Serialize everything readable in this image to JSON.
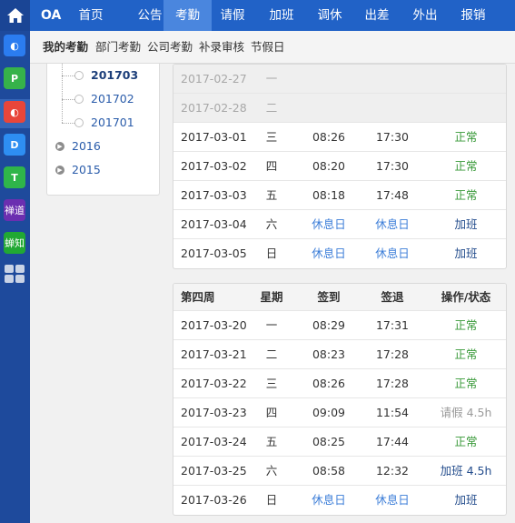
{
  "rail": {
    "apps": [
      {
        "name": "app-c-blue",
        "glyph": "◐",
        "color": "#2b7cf0"
      },
      {
        "name": "app-p-green",
        "glyph": "P",
        "color": "#36b24a"
      },
      {
        "name": "app-d-red",
        "glyph": "◐",
        "color": "#e8463a"
      },
      {
        "name": "app-d-blue",
        "glyph": "D",
        "color": "#2e8ef2"
      },
      {
        "name": "app-t-green",
        "glyph": "T",
        "color": "#2fb54a"
      },
      {
        "name": "app-chandao",
        "glyph": "禅道",
        "color": "#6b2fb0"
      },
      {
        "name": "app-chanzhi",
        "glyph": "蝉知",
        "color": "#21a834"
      }
    ]
  },
  "topbar": {
    "brand": "OA",
    "nav": [
      "首页",
      "公告",
      "考勤",
      "请假",
      "加班",
      "调休",
      "出差",
      "外出",
      "报销"
    ],
    "active": "考勤"
  },
  "subbar": {
    "items": [
      "我的考勤",
      "部门考勤",
      "公司考勤",
      "补录审核",
      "节假日"
    ],
    "active": "我的考勤"
  },
  "tree": {
    "months": [
      "201703",
      "201702",
      "201701"
    ],
    "active_month": "201703",
    "years": [
      "2016",
      "2015"
    ]
  },
  "week_prev": {
    "rows": [
      {
        "date": "2017-02-27",
        "weekday": "一",
        "in": "",
        "out": "",
        "status": "",
        "grey": true
      },
      {
        "date": "2017-02-28",
        "weekday": "二",
        "in": "",
        "out": "",
        "status": "",
        "grey": true
      },
      {
        "date": "2017-03-01",
        "weekday": "三",
        "in": "08:26",
        "out": "17:30",
        "status": "正常"
      },
      {
        "date": "2017-03-02",
        "weekday": "四",
        "in": "08:20",
        "out": "17:30",
        "status": "正常"
      },
      {
        "date": "2017-03-03",
        "weekday": "五",
        "in": "08:18",
        "out": "17:48",
        "status": "正常"
      },
      {
        "date": "2017-03-04",
        "weekday": "六",
        "in": "休息日",
        "out": "休息日",
        "status": "加班"
      },
      {
        "date": "2017-03-05",
        "weekday": "日",
        "in": "休息日",
        "out": "休息日",
        "status": "加班"
      }
    ]
  },
  "week4": {
    "headers": [
      "第四周",
      "星期",
      "签到",
      "签退",
      "操作/状态"
    ],
    "rows": [
      {
        "date": "2017-03-20",
        "weekday": "一",
        "in": "08:29",
        "out": "17:31",
        "status": "正常"
      },
      {
        "date": "2017-03-21",
        "weekday": "二",
        "in": "08:23",
        "out": "17:28",
        "status": "正常"
      },
      {
        "date": "2017-03-22",
        "weekday": "三",
        "in": "08:26",
        "out": "17:28",
        "status": "正常"
      },
      {
        "date": "2017-03-23",
        "weekday": "四",
        "in": "09:09",
        "out": "11:54",
        "status": "请假 4.5h"
      },
      {
        "date": "2017-03-24",
        "weekday": "五",
        "in": "08:25",
        "out": "17:44",
        "status": "正常"
      },
      {
        "date": "2017-03-25",
        "weekday": "六",
        "in": "08:58",
        "out": "12:32",
        "status": "加班 4.5h"
      },
      {
        "date": "2017-03-26",
        "weekday": "日",
        "in": "休息日",
        "out": "休息日",
        "status": "加班"
      }
    ]
  },
  "colors": {
    "topbar": "#2162c7",
    "nav_active": "#4a86de",
    "rail": "#1e4a9c",
    "normal_status": "#3a9a3a",
    "rest_day": "#3b7dd8",
    "overtime": "#234c8c",
    "leave": "#9a9a9a"
  }
}
